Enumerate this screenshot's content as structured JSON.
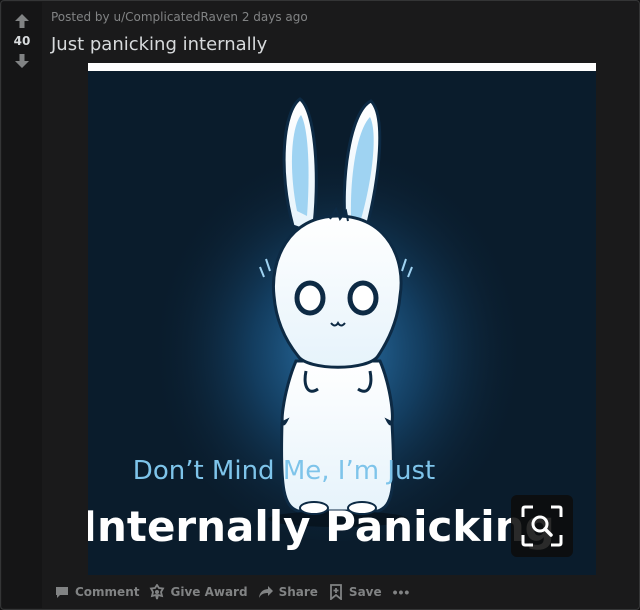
{
  "post": {
    "meta_prefix": "Posted by ",
    "author": "u/ComplicatedRaven",
    "time_ago": "2 days ago",
    "title": "Just panicking internally",
    "vote_count": "40"
  },
  "image": {
    "caption_line1": "Don’t Mind Me, I’m Just",
    "caption_line2": "Internally Panicking"
  },
  "actions": {
    "comment": "Comment",
    "give_award": "Give Award",
    "share": "Share",
    "save": "Save",
    "more": "•••"
  },
  "colors": {
    "background": "#1a1a1b",
    "text": "#d7dadc",
    "muted": "#818384",
    "art_background": "#0a1c2c",
    "caption_blue": "#7ec4ea"
  },
  "icons": [
    "upvote-icon",
    "downvote-icon",
    "comment-icon",
    "award-icon",
    "share-icon",
    "save-icon",
    "more-icon",
    "zoom-search-icon"
  ]
}
